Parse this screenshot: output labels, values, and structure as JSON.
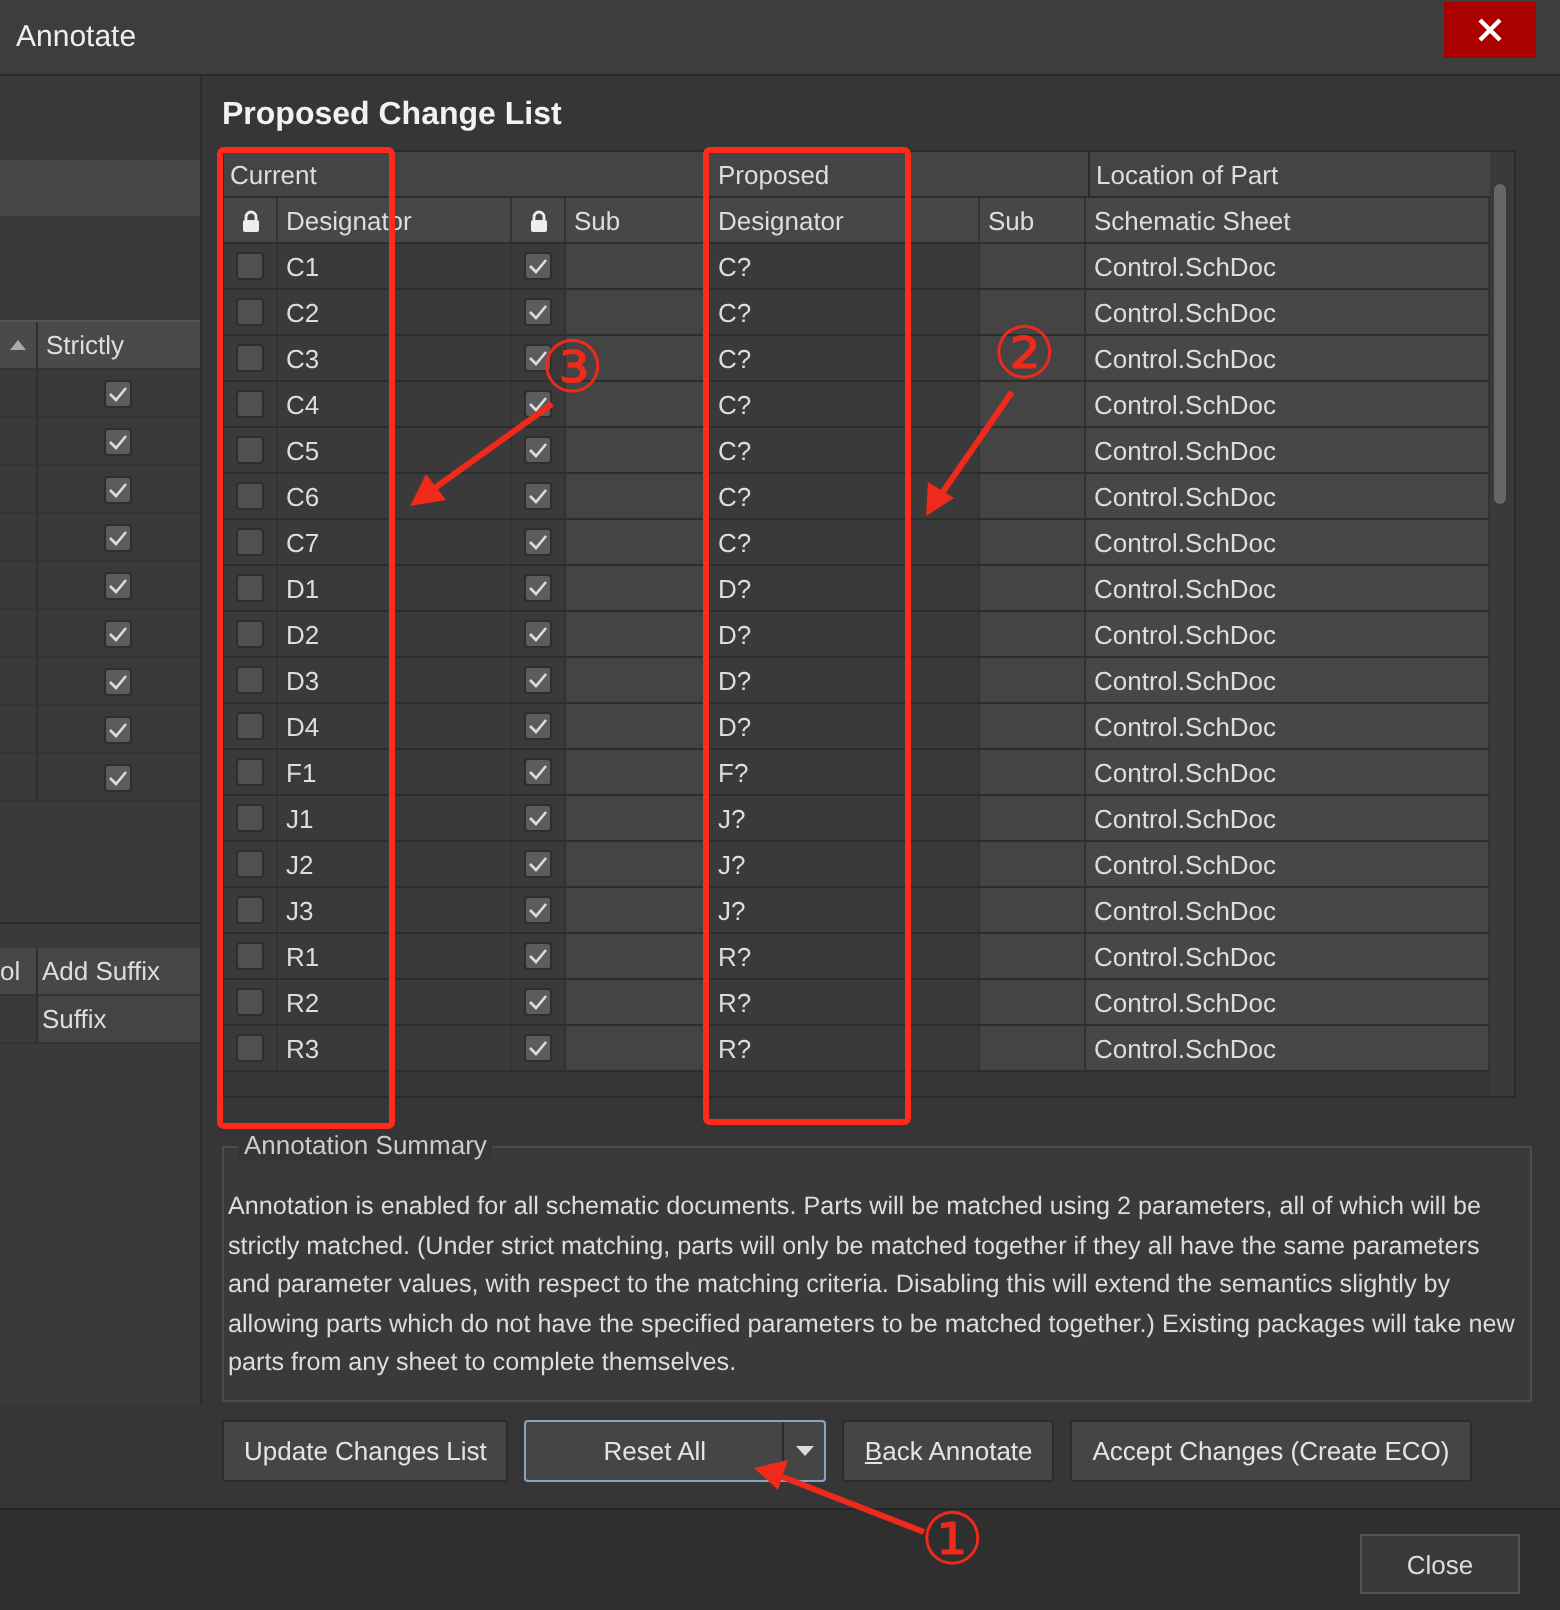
{
  "window": {
    "title": "Annotate"
  },
  "left_panel": {
    "matching_table": {
      "column": "Strictly",
      "rows": [
        {
          "strictly": true
        },
        {
          "strictly": true
        },
        {
          "strictly": true
        },
        {
          "strictly": true
        },
        {
          "strictly": true
        },
        {
          "strictly": true
        },
        {
          "strictly": true
        },
        {
          "strictly": true
        },
        {
          "strictly": true
        }
      ]
    },
    "suffix_table": {
      "columns": [
        "ol",
        "Add Suffix"
      ],
      "row_cell": "Suffix"
    }
  },
  "change_list": {
    "title": "Proposed Change List",
    "groups": [
      "Current",
      "Proposed",
      "Location of Part"
    ],
    "columns": [
      "Designator",
      "Sub",
      "Designator",
      "Sub",
      "Schematic Sheet"
    ],
    "rows": [
      {
        "current": "C1",
        "current_locked": false,
        "sub_locked": true,
        "proposed": "C?",
        "sheet": "Control.SchDoc"
      },
      {
        "current": "C2",
        "current_locked": false,
        "sub_locked": true,
        "proposed": "C?",
        "sheet": "Control.SchDoc"
      },
      {
        "current": "C3",
        "current_locked": false,
        "sub_locked": true,
        "proposed": "C?",
        "sheet": "Control.SchDoc"
      },
      {
        "current": "C4",
        "current_locked": false,
        "sub_locked": true,
        "proposed": "C?",
        "sheet": "Control.SchDoc"
      },
      {
        "current": "C5",
        "current_locked": false,
        "sub_locked": true,
        "proposed": "C?",
        "sheet": "Control.SchDoc"
      },
      {
        "current": "C6",
        "current_locked": false,
        "sub_locked": true,
        "proposed": "C?",
        "sheet": "Control.SchDoc"
      },
      {
        "current": "C7",
        "current_locked": false,
        "sub_locked": true,
        "proposed": "C?",
        "sheet": "Control.SchDoc"
      },
      {
        "current": "D1",
        "current_locked": false,
        "sub_locked": true,
        "proposed": "D?",
        "sheet": "Control.SchDoc"
      },
      {
        "current": "D2",
        "current_locked": false,
        "sub_locked": true,
        "proposed": "D?",
        "sheet": "Control.SchDoc"
      },
      {
        "current": "D3",
        "current_locked": false,
        "sub_locked": true,
        "proposed": "D?",
        "sheet": "Control.SchDoc"
      },
      {
        "current": "D4",
        "current_locked": false,
        "sub_locked": true,
        "proposed": "D?",
        "sheet": "Control.SchDoc"
      },
      {
        "current": "F1",
        "current_locked": false,
        "sub_locked": true,
        "proposed": "F?",
        "sheet": "Control.SchDoc"
      },
      {
        "current": "J1",
        "current_locked": false,
        "sub_locked": true,
        "proposed": "J?",
        "sheet": "Control.SchDoc"
      },
      {
        "current": "J2",
        "current_locked": false,
        "sub_locked": true,
        "proposed": "J?",
        "sheet": "Control.SchDoc"
      },
      {
        "current": "J3",
        "current_locked": false,
        "sub_locked": true,
        "proposed": "J?",
        "sheet": "Control.SchDoc"
      },
      {
        "current": "R1",
        "current_locked": false,
        "sub_locked": true,
        "proposed": "R?",
        "sheet": "Control.SchDoc"
      },
      {
        "current": "R2",
        "current_locked": false,
        "sub_locked": true,
        "proposed": "R?",
        "sheet": "Control.SchDoc"
      },
      {
        "current": "R3",
        "current_locked": false,
        "sub_locked": true,
        "proposed": "R?",
        "sheet": "Control.SchDoc"
      }
    ]
  },
  "summary": {
    "title": "Annotation Summary",
    "text": "Annotation is enabled for all schematic documents. Parts will be matched using 2 parameters, all of which will be strictly matched. (Under strict matching, parts will only be matched together if they all have the same parameters and parameter values, with respect to the matching criteria. Disabling this will extend the semantics slightly by allowing parts which do not have the specified parameters to be matched together.) Existing packages will take new parts from any sheet to complete themselves."
  },
  "buttons": [
    {
      "label": "Update Changes List",
      "kind": "plain",
      "focused": false
    },
    {
      "label": "Reset All",
      "kind": "split",
      "focused": true
    },
    {
      "label": "Back Annotate",
      "kind": "plain",
      "focused": false
    },
    {
      "label": "Accept Changes (Create ECO)",
      "kind": "plain",
      "focused": false
    }
  ],
  "close_button": {
    "label": "Close"
  },
  "annotations": [
    {
      "label": "③"
    },
    {
      "label": "②"
    },
    {
      "label": "①"
    }
  ]
}
